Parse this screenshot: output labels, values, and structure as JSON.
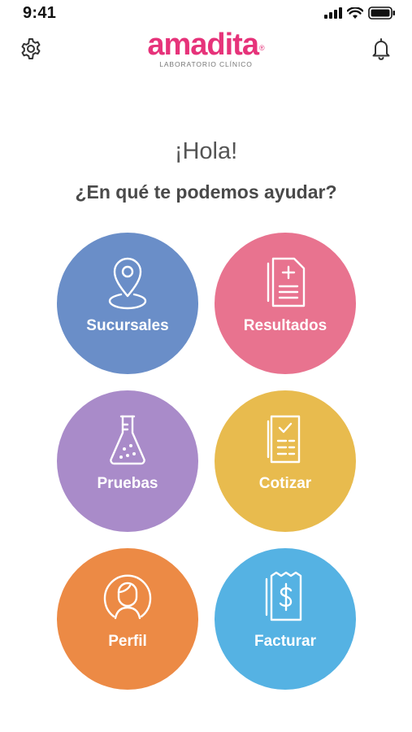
{
  "status_bar": {
    "time": "9:41",
    "icons": [
      "signal-icon",
      "wifi-icon",
      "battery-icon"
    ]
  },
  "header": {
    "logo_text": "amadita",
    "logo_mark": "®",
    "logo_subtitle": "LABORATORIO CLÍNICO",
    "left_icon": "gear-icon",
    "right_icon": "bell-icon"
  },
  "main": {
    "greeting": "¡Hola!",
    "question": "¿En qué te podemos ayudar?"
  },
  "menu": [
    {
      "label": "Sucursales",
      "icon": "location-pin-icon",
      "color": "#6a8ec8"
    },
    {
      "label": "Resultados",
      "icon": "document-plus-icon",
      "color": "#e8738f"
    },
    {
      "label": "Pruebas",
      "icon": "flask-icon",
      "color": "#a98bc9"
    },
    {
      "label": "Cotizar",
      "icon": "checklist-icon",
      "color": "#e8bb4e"
    },
    {
      "label": "Perfil",
      "icon": "user-avatar-icon",
      "color": "#ec8a45"
    },
    {
      "label": "Facturar",
      "icon": "receipt-dollar-icon",
      "color": "#55b2e3"
    }
  ],
  "colors": {
    "brand": "#e6337a",
    "text": "#4a4a4a"
  }
}
